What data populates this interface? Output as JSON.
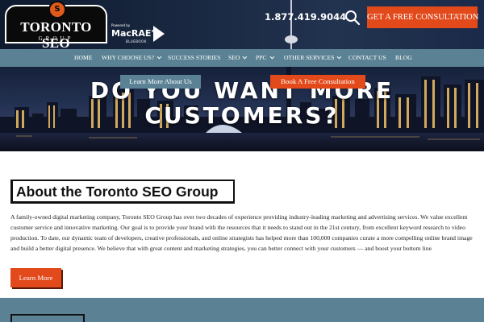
{
  "header": {
    "logo": {
      "title": "TORONTO SEO",
      "subtitle": "GROUP",
      "mark": "S"
    },
    "partner": {
      "powered_by": "Powered by",
      "name": "MacRAE'S",
      "sub": "BLUEBOOK"
    },
    "phone": "1.877.419.9044",
    "search_icon": "search-icon",
    "cta_label": "GET A FREE CONSULTATION"
  },
  "nav": {
    "items": [
      {
        "label": "HOME",
        "dropdown": false
      },
      {
        "label": "WHY CHOOSE US?",
        "dropdown": true
      },
      {
        "label": "SUCCESS STORIES",
        "dropdown": false
      },
      {
        "label": "SEO",
        "dropdown": true
      },
      {
        "label": "PPC",
        "dropdown": true
      },
      {
        "label": "OTHER SERVICES",
        "dropdown": true
      },
      {
        "label": "CONTACT US",
        "dropdown": false
      },
      {
        "label": "BLOG",
        "dropdown": false
      }
    ]
  },
  "hero": {
    "title_line1": "DO YOU WANT MORE",
    "title_line2": "CUSTOMERS?",
    "learn_label": "Learn More About Us",
    "book_label": "Book A Free Consultation"
  },
  "about": {
    "heading": "About the Toronto SEO Group",
    "body": "A family-owned digital marketing company, Toronto SEO Group has over two decades of experience providing industry-leading marketing and advertising services. We value excellent customer service and innovative marketing. Our goal is to provide your brand with the resources that it needs to stand out in the 21st century, from excellent keyword research to video production. To date, our dynamic team of developers, creative professionals, and online strategists has helped more than 100,000 companies curate a more compelling online brand image and build a better digital presence. We believe that with great content and marketing strategies, you can better connect with your customers — and boost your bottom line",
    "button_label": "Learn More"
  },
  "colors": {
    "accent": "#e24a1c",
    "nav": "#5b8294",
    "header_bg": "#1b2a44"
  }
}
